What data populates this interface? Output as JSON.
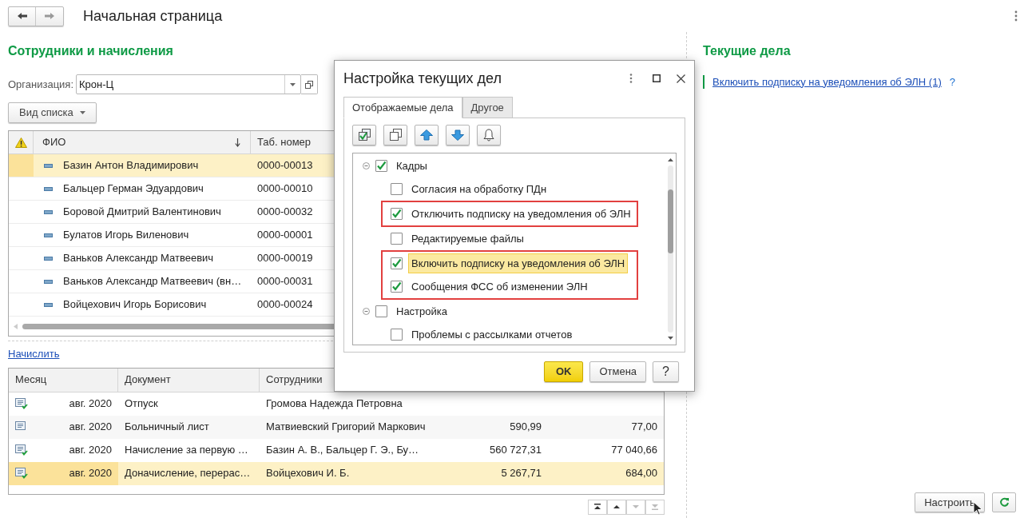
{
  "header": {
    "title": "Начальная страница"
  },
  "employees": {
    "title": "Сотрудники и начисления",
    "organization": {
      "label": "Организация:",
      "value": "Крон-Ц"
    },
    "view_button": "Вид списка",
    "columns": [
      "ФИО",
      "Таб. номер"
    ],
    "rows": [
      {
        "name": "Базин Антон Владимирович",
        "number": "0000-00013",
        "selected": true
      },
      {
        "name": "Бальцер Герман Эдуардович",
        "number": "0000-00010",
        "selected": false
      },
      {
        "name": "Боровой Дмитрий Валентинович",
        "number": "0000-00032",
        "selected": false
      },
      {
        "name": "Булатов Игорь Виленович",
        "number": "0000-00001",
        "selected": false
      },
      {
        "name": "Ваньков Александр Матвеевич",
        "number": "0000-00019",
        "selected": false
      },
      {
        "name": "Ваньков Александр Матвеевич (вн…",
        "number": "0000-00031",
        "selected": false
      },
      {
        "name": "Войцехович Игорь Борисович",
        "number": "0000-00024",
        "selected": false
      }
    ]
  },
  "accrue_link": "Начислить",
  "documents": {
    "columns": [
      "Месяц",
      "Документ",
      "Сотрудники"
    ],
    "rows": [
      {
        "posted": true,
        "month": "авг. 2020",
        "document": "Отпуск",
        "employees": "Громова Надежда Петровна",
        "selected": false
      },
      {
        "posted": false,
        "month": "авг. 2020",
        "document": "Больничный лист",
        "employees": "Матвиевский Григорий Маркович",
        "column_4": "590,99",
        "column_5": "77,00",
        "selected": false
      },
      {
        "posted": true,
        "month": "авг. 2020",
        "document": "Начисление за первую …",
        "employees": "Базин А. В., Бальцер Г. Э., Бу…",
        "column_4": "560 727,31",
        "column_5": "77 040,66",
        "selected": false
      },
      {
        "posted": true,
        "month": "авг. 2020",
        "document": "Доначисление, перерас…",
        "employees": "Войцехович И. Б.",
        "column_4": "5 267,71",
        "column_5": "684,00",
        "selected": true
      }
    ]
  },
  "current_tasks": {
    "title": "Текущие дела",
    "items": [
      {
        "label": "Включить подписку на уведомления об ЭЛН (1)",
        "help": "?"
      }
    ]
  },
  "dialog": {
    "title": "Настройка текущих дел",
    "tabs": [
      {
        "label": "Отображаемые дела",
        "selected": true
      },
      {
        "label": "Другое",
        "selected": false
      }
    ],
    "tree": [
      {
        "label": "Кадры",
        "checked": true,
        "expanded": true,
        "children": [
          {
            "label": "Согласия на обработку ПДн",
            "checked": false,
            "outlined": false,
            "selected": false
          },
          {
            "label": "Отключить подписку на уведомления об ЭЛН",
            "checked": true,
            "outlined": true,
            "selected": false
          },
          {
            "label": "Редактируемые файлы",
            "checked": false,
            "outlined": false,
            "selected": false
          },
          {
            "label": "Включить подписку на уведомления об ЭЛН",
            "checked": true,
            "outlined": true,
            "selected": true
          },
          {
            "label": "Сообщения ФСС об изменении ЭЛН",
            "checked": true,
            "outlined": true,
            "selected": false
          }
        ]
      },
      {
        "label": "Настройка",
        "checked": false,
        "expanded": true,
        "children": [
          {
            "label": "Проблемы с рассылками отчетов",
            "checked": false,
            "outlined": false,
            "selected": false
          }
        ]
      }
    ],
    "buttons": [
      {
        "label": "OK",
        "default": true
      },
      {
        "label": "Отмена",
        "default": false
      },
      {
        "label": "?",
        "default": false
      }
    ]
  },
  "footer": {
    "settings_button": "Настроить"
  }
}
